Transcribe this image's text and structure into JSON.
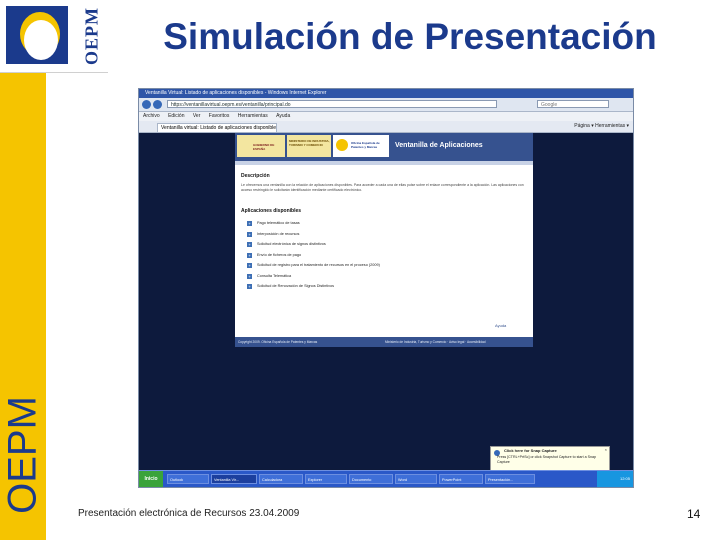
{
  "slide": {
    "title": "Simulación de Presentación",
    "side_text": "OEPM",
    "logo_text": "OEPM",
    "footer": "Presentación electrónica de Recursos 23.04.2009",
    "page_number": "14",
    "colors": {
      "accent": "#f5c400",
      "brand": "#1b3a8c"
    }
  },
  "browser": {
    "window_title": "Ventanilla Virtual: Listado de aplicaciones disponibles - Windows Internet Explorer",
    "address": "https://ventanillavirtual.oepm.es/ventanilla/principal.do",
    "search_placeholder": "Google",
    "menu": [
      "Archivo",
      "Edición",
      "Ver",
      "Favoritos",
      "Herramientas",
      "Ayuda"
    ],
    "tab_label": "Ventanilla virtual: Listado de aplicaciones disponibles",
    "tab_tools": "Página ▾  Herramientas ▾"
  },
  "webpage": {
    "logo1": "GOBIERNO DE ESPAÑA",
    "logo2": "MINISTERIO DE INDUSTRIA, TURISMO Y COMERCIO",
    "logo3": "Oficina Española de Patentes y Marcas",
    "app_title": "Ventanilla de Aplicaciones",
    "section_description": "Descripción",
    "description": "Le ofrecemos una ventanilla con la relación de aplicaciones disponibles. Para acceder a cada una de ellas pulse sobre el enlace correspondiente a la aplicación. Las aplicaciones con acceso restringido le solicitarán identificación mediante certificado electrónico.",
    "section_apps": "Aplicaciones disponibles",
    "apps": [
      "Pago telemático de tasas",
      "Interposición de recursos",
      "Solicitud electrónica de signos distintivos",
      "Envío de ficheros de pago",
      "Solicitud de registro para el tratamiento de recursos en el proceso (2009)",
      "Consulta Telemática",
      "Solicitud de Renovación de Signos Distintivos"
    ],
    "help": "Ayuda",
    "footer_left": "Copyright 2009. Oficina Española de Patentes y Marcas",
    "footer_right": "Ministerio de Industria, Turismo y Comercio · Aviso legal · Accesibilidad"
  },
  "notification": {
    "title": "Click here for Snap Capture",
    "body": "Press [CTRL+PrtSc] or click Snapshot Capture to start a Snap Capture"
  },
  "taskbar": {
    "start": "Inicio",
    "tasks": [
      "Outlook",
      "Ventanilla Vir...",
      "Calculadora",
      "Explorer",
      "Documento",
      "Word",
      "PowerPoint",
      "Presentación..."
    ],
    "clock": "12:05"
  }
}
